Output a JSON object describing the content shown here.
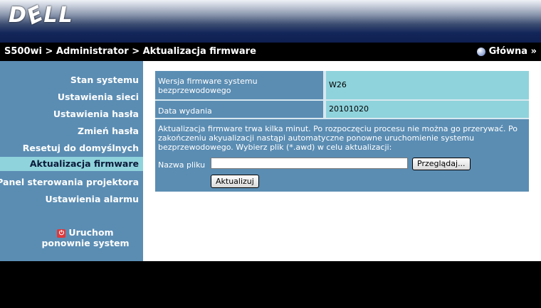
{
  "brand": {
    "logo_d": "D",
    "logo_e": "E",
    "logo_ll": "LL"
  },
  "breadcrumb": "S500wi > Administrator > Aktualizacja firmware",
  "home_label": "Główna »",
  "sidebar": {
    "items": [
      {
        "label": "Stan systemu"
      },
      {
        "label": "Ustawienia sieci"
      },
      {
        "label": "Ustawienia hasła"
      },
      {
        "label": "Zmień hasła"
      },
      {
        "label": "Resetuj do domyślnych"
      },
      {
        "label": "Aktualizacja firmware",
        "active": true
      },
      {
        "label": "Panel sterowania projektora"
      },
      {
        "label": "Ustawienia alarmu"
      }
    ],
    "restart_label": "Uruchom ponownie system"
  },
  "firmware": {
    "version_label": "Wersja firmware systemu bezprzewodowego",
    "version_value": "W26",
    "release_label": "Data wydania",
    "release_value": "20101020",
    "description": "Aktualizacja firmware trwa kilka minut. Po rozpoczęciu procesu nie można go przerywać. Po zakończeniu akyualizacji nastąpi automatyczne ponowne uruchomienie systemu bezprzewodowego. Wybierz plik (*.awd) w celu aktualizacji:",
    "file_label": "Nazwa pliku",
    "file_value": "",
    "browse_label": "Przeglądaj...",
    "update_label": "Aktualizuj"
  },
  "colors": {
    "panel": "#5b8db3",
    "value_cell": "#8fd3dc",
    "header_dark": "#0e1f50"
  }
}
